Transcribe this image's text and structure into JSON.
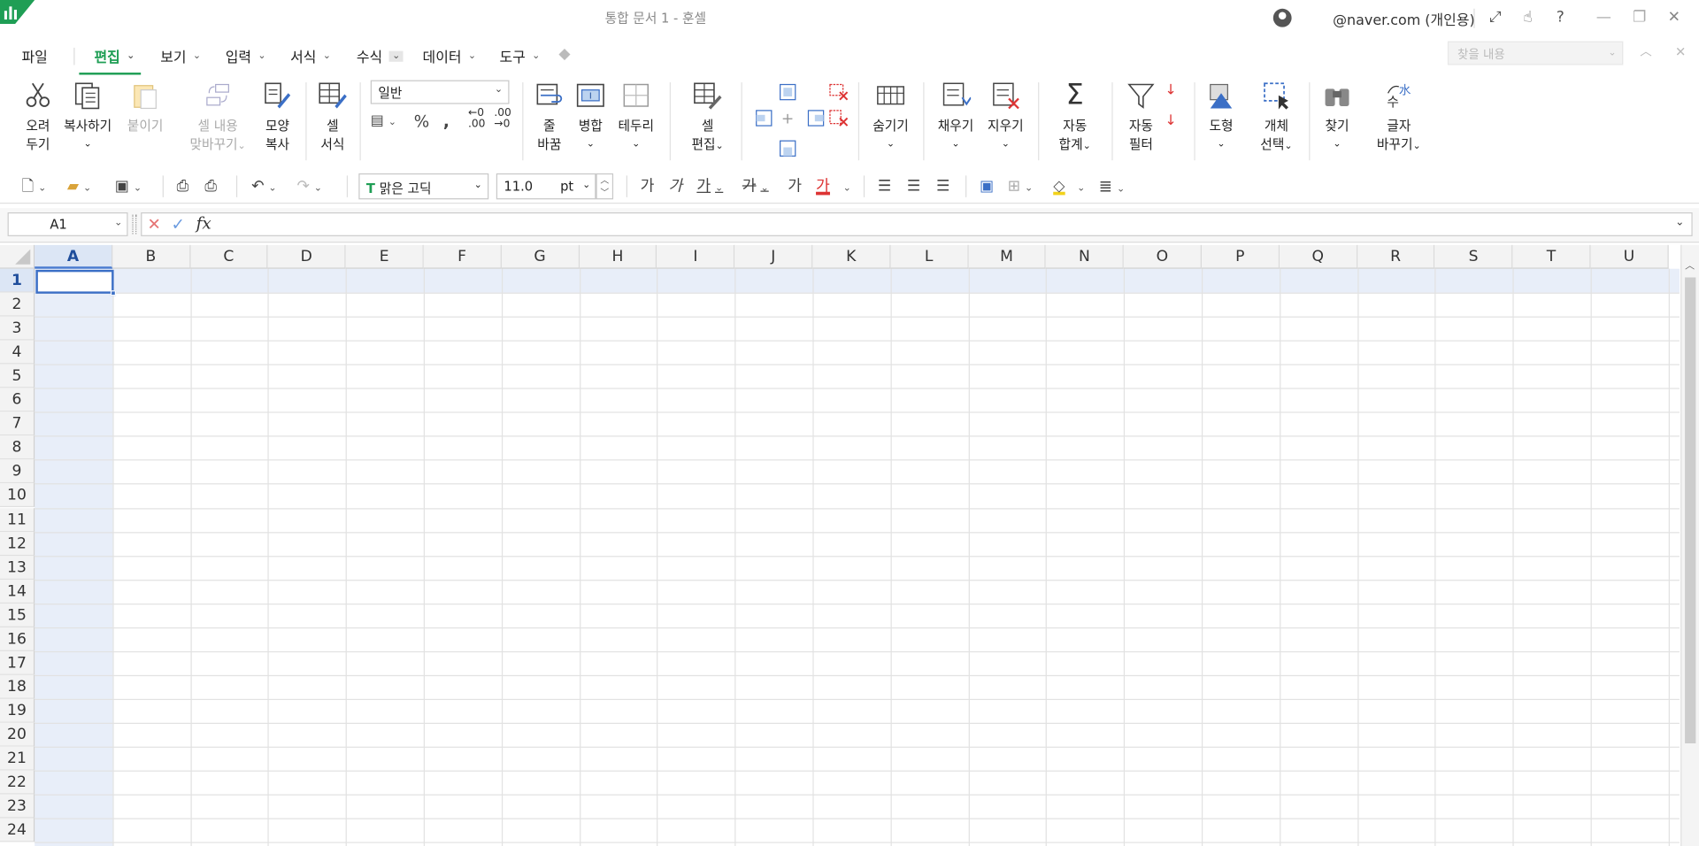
{
  "title": {
    "document": "통합 문서 1 - 훈셀",
    "user": "@naver.com (개인용)"
  },
  "menu": {
    "file": "파일",
    "tabs": [
      "편집",
      "보기",
      "입력",
      "서식",
      "수식",
      "데이터",
      "도구"
    ],
    "active_tab": "편집",
    "search_placeholder": "찾을 내용"
  },
  "ribbon": {
    "cut": [
      "오려",
      "두기"
    ],
    "copy": "복사하기",
    "paste": "붙이기",
    "transpose": [
      "셀 내용",
      "맞바꾸기"
    ],
    "format_painter": [
      "모양",
      "복사"
    ],
    "cell_style": [
      "셀",
      "서식"
    ],
    "number_format": "일반",
    "wrap": [
      "줄",
      "바꿈"
    ],
    "merge": "병합",
    "border": "테두리",
    "cell_edit": [
      "셀",
      "편집"
    ],
    "hide": "숨기기",
    "fill": "채우기",
    "clear": "지우기",
    "autosum": [
      "자동",
      "합계"
    ],
    "autofilter": [
      "자동",
      "필터"
    ],
    "shape": "도형",
    "select_object": [
      "개체",
      "선택"
    ],
    "find": "찾기",
    "replace": [
      "글자",
      "바꾸기"
    ]
  },
  "toolbar": {
    "font": "맑은 고딕",
    "font_size": "11.0",
    "size_unit": "pt",
    "glyph_bold": "가",
    "glyph_italic": "가",
    "glyph_underline": "가",
    "glyph_strike": "가",
    "glyph_plain": "가",
    "glyph_color": "가"
  },
  "formula_bar": {
    "name_box": "A1",
    "formula": ""
  },
  "sheet": {
    "columns": [
      "A",
      "B",
      "C",
      "D",
      "E",
      "F",
      "G",
      "H",
      "I",
      "J",
      "K",
      "L",
      "M",
      "N",
      "O",
      "P",
      "Q",
      "R",
      "S",
      "T",
      "U"
    ],
    "rows": [
      "1",
      "2",
      "3",
      "4",
      "5",
      "6",
      "7",
      "8",
      "9",
      "10",
      "11",
      "12",
      "13",
      "14",
      "15",
      "16",
      "17",
      "18",
      "19",
      "20",
      "21",
      "22",
      "23",
      "24"
    ],
    "selected_cell": "A1"
  },
  "colors": {
    "accent": "#1f9e55",
    "selection": "#3b6fc6",
    "selection_band": "#e8eef9"
  }
}
